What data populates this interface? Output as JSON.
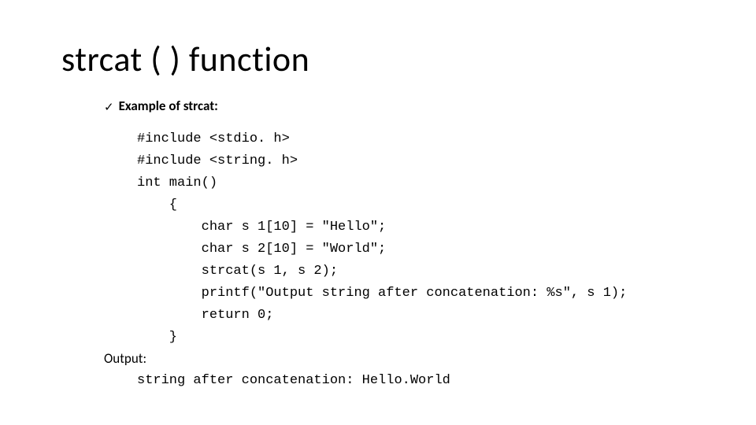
{
  "title": "strcat ( ) function",
  "bullet": "Example of strcat:",
  "code": {
    "l1": "#include <stdio. h>",
    "l2": "#include <string. h>",
    "l3": "int main()",
    "l4": "    {",
    "l5": "        char s 1[10] = \"Hello\";",
    "l6": "        char s 2[10] = \"World\";",
    "l7": "        strcat(s 1, s 2);",
    "l8": "        printf(\"Output string after concatenation: %s\", s 1);",
    "l9": "        return 0;",
    "l10": "    }"
  },
  "output_label": "Output:",
  "output_text": "string after concatenation: Hello.World"
}
